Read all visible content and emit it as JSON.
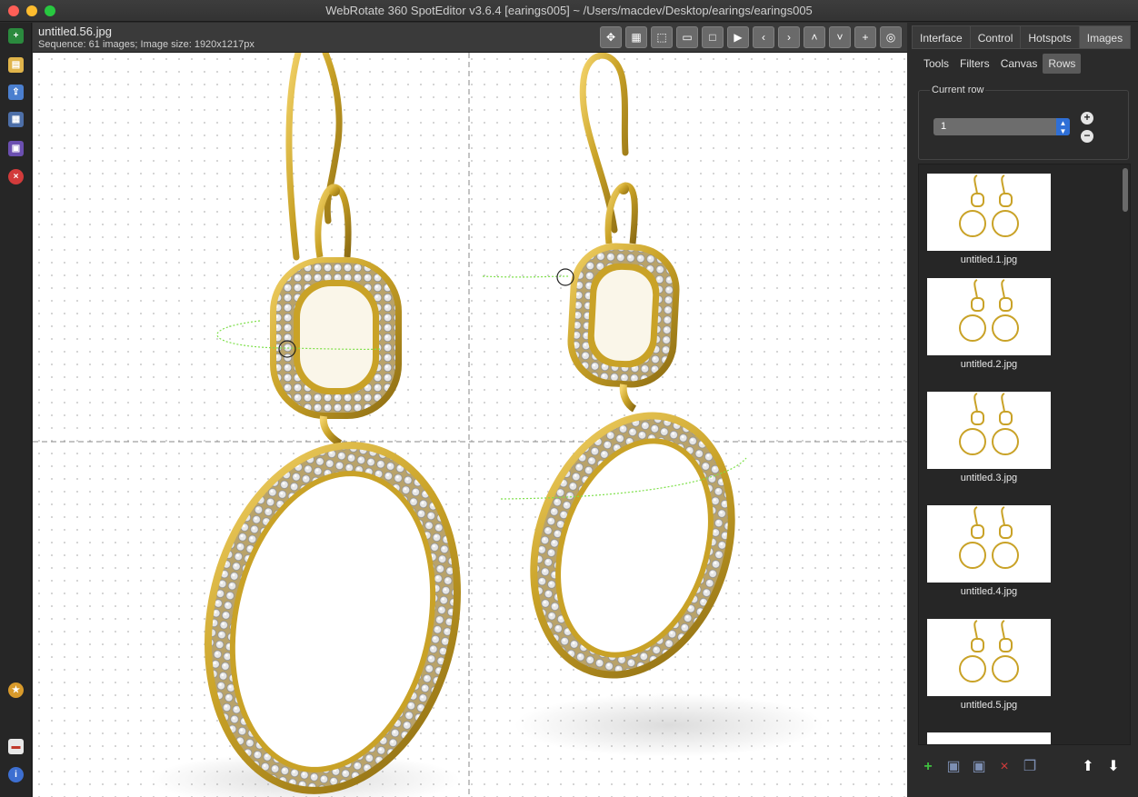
{
  "window": {
    "title": "WebRotate 360 SpotEditor v3.6.4 [earings005] ~ /Users/macdev/Desktop/earings/earings005"
  },
  "editor": {
    "file_name": "untitled.56.jpg",
    "sequence_info": "Sequence: 61 images; Image size: 1920x1217px"
  },
  "toolbar_icons": [
    "move-icon",
    "grid-icon",
    "marquee-icon",
    "frame-icon",
    "fit-icon",
    "play-icon",
    "arrow-left-icon",
    "arrow-right-icon",
    "arrow-up-icon",
    "arrow-down-icon",
    "plus-icon",
    "target-icon"
  ],
  "left_toolbar_icons": [
    "add-project-icon",
    "open-folder-icon",
    "publish-icon",
    "print-icon",
    "save-icon",
    "close-project-icon",
    "award-icon",
    "pdf-icon",
    "info-icon"
  ],
  "tabs": [
    {
      "label": "Interface"
    },
    {
      "label": "Control"
    },
    {
      "label": "Hotspots"
    },
    {
      "label": "Images"
    }
  ],
  "subtabs": [
    {
      "label": "Tools"
    },
    {
      "label": "Filters"
    },
    {
      "label": "Canvas"
    },
    {
      "label": "Rows"
    }
  ],
  "rows": {
    "group_title": "Current row",
    "current_row": "1"
  },
  "thumbnails": [
    {
      "label": "untitled.1.jpg"
    },
    {
      "label": "untitled.2.jpg"
    },
    {
      "label": "untitled.3.jpg"
    },
    {
      "label": "untitled.4.jpg"
    },
    {
      "label": "untitled.5.jpg"
    }
  ],
  "bottom_icons": [
    "add-image-icon",
    "insert-image-icon",
    "replace-image-icon",
    "delete-image-icon",
    "duplicate-image-icon",
    "move-up-icon",
    "move-down-icon"
  ],
  "colors": {
    "gold": "#c9a227",
    "path_green": "#7ee04a",
    "accent_blue": "#2f6fd6"
  }
}
